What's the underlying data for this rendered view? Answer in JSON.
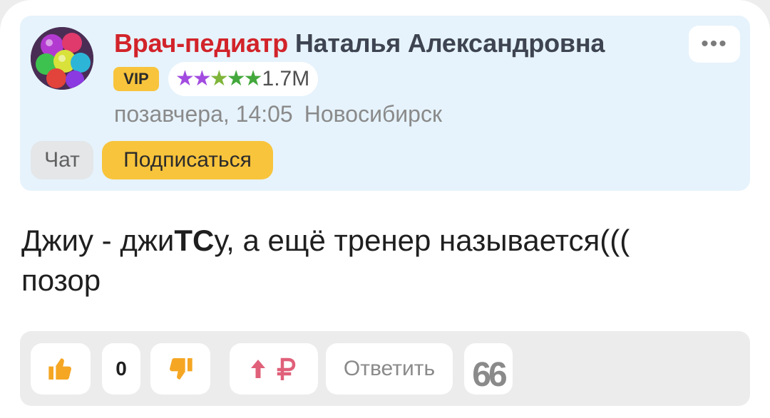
{
  "author": {
    "role": "Врач-педиатр",
    "name": "Наталья Александровна",
    "vip_label": "VIP",
    "rating": "1.7M",
    "stars": [
      "★",
      "★",
      "★",
      "★",
      "★"
    ],
    "star_colors": [
      "#a24be0",
      "#a24be0",
      "#7fb53a",
      "#43a83c",
      "#43a83c"
    ],
    "time": "позавчера, 14:05",
    "city": "Новосибирск",
    "menu_icon": "•••"
  },
  "buttons": {
    "chat": "Чат",
    "subscribe": "Подписаться"
  },
  "post": {
    "text_before": "Джиу - джи",
    "text_bold": "ТС",
    "text_after": "у, а ещё тренер называется(((",
    "text_line2": "позор"
  },
  "actions": {
    "likes_count": "0",
    "reply": "Ответить",
    "quote": "66",
    "like_icon": "thumbs-up-icon",
    "dislike_icon": "thumbs-down-icon",
    "boost_icon": "arrow-up-ruble-icon"
  },
  "colors": {
    "role": "#d2232a",
    "accent_yellow": "#f8c43c",
    "thumbs": "#f5a623",
    "boost": "#e0607a"
  }
}
